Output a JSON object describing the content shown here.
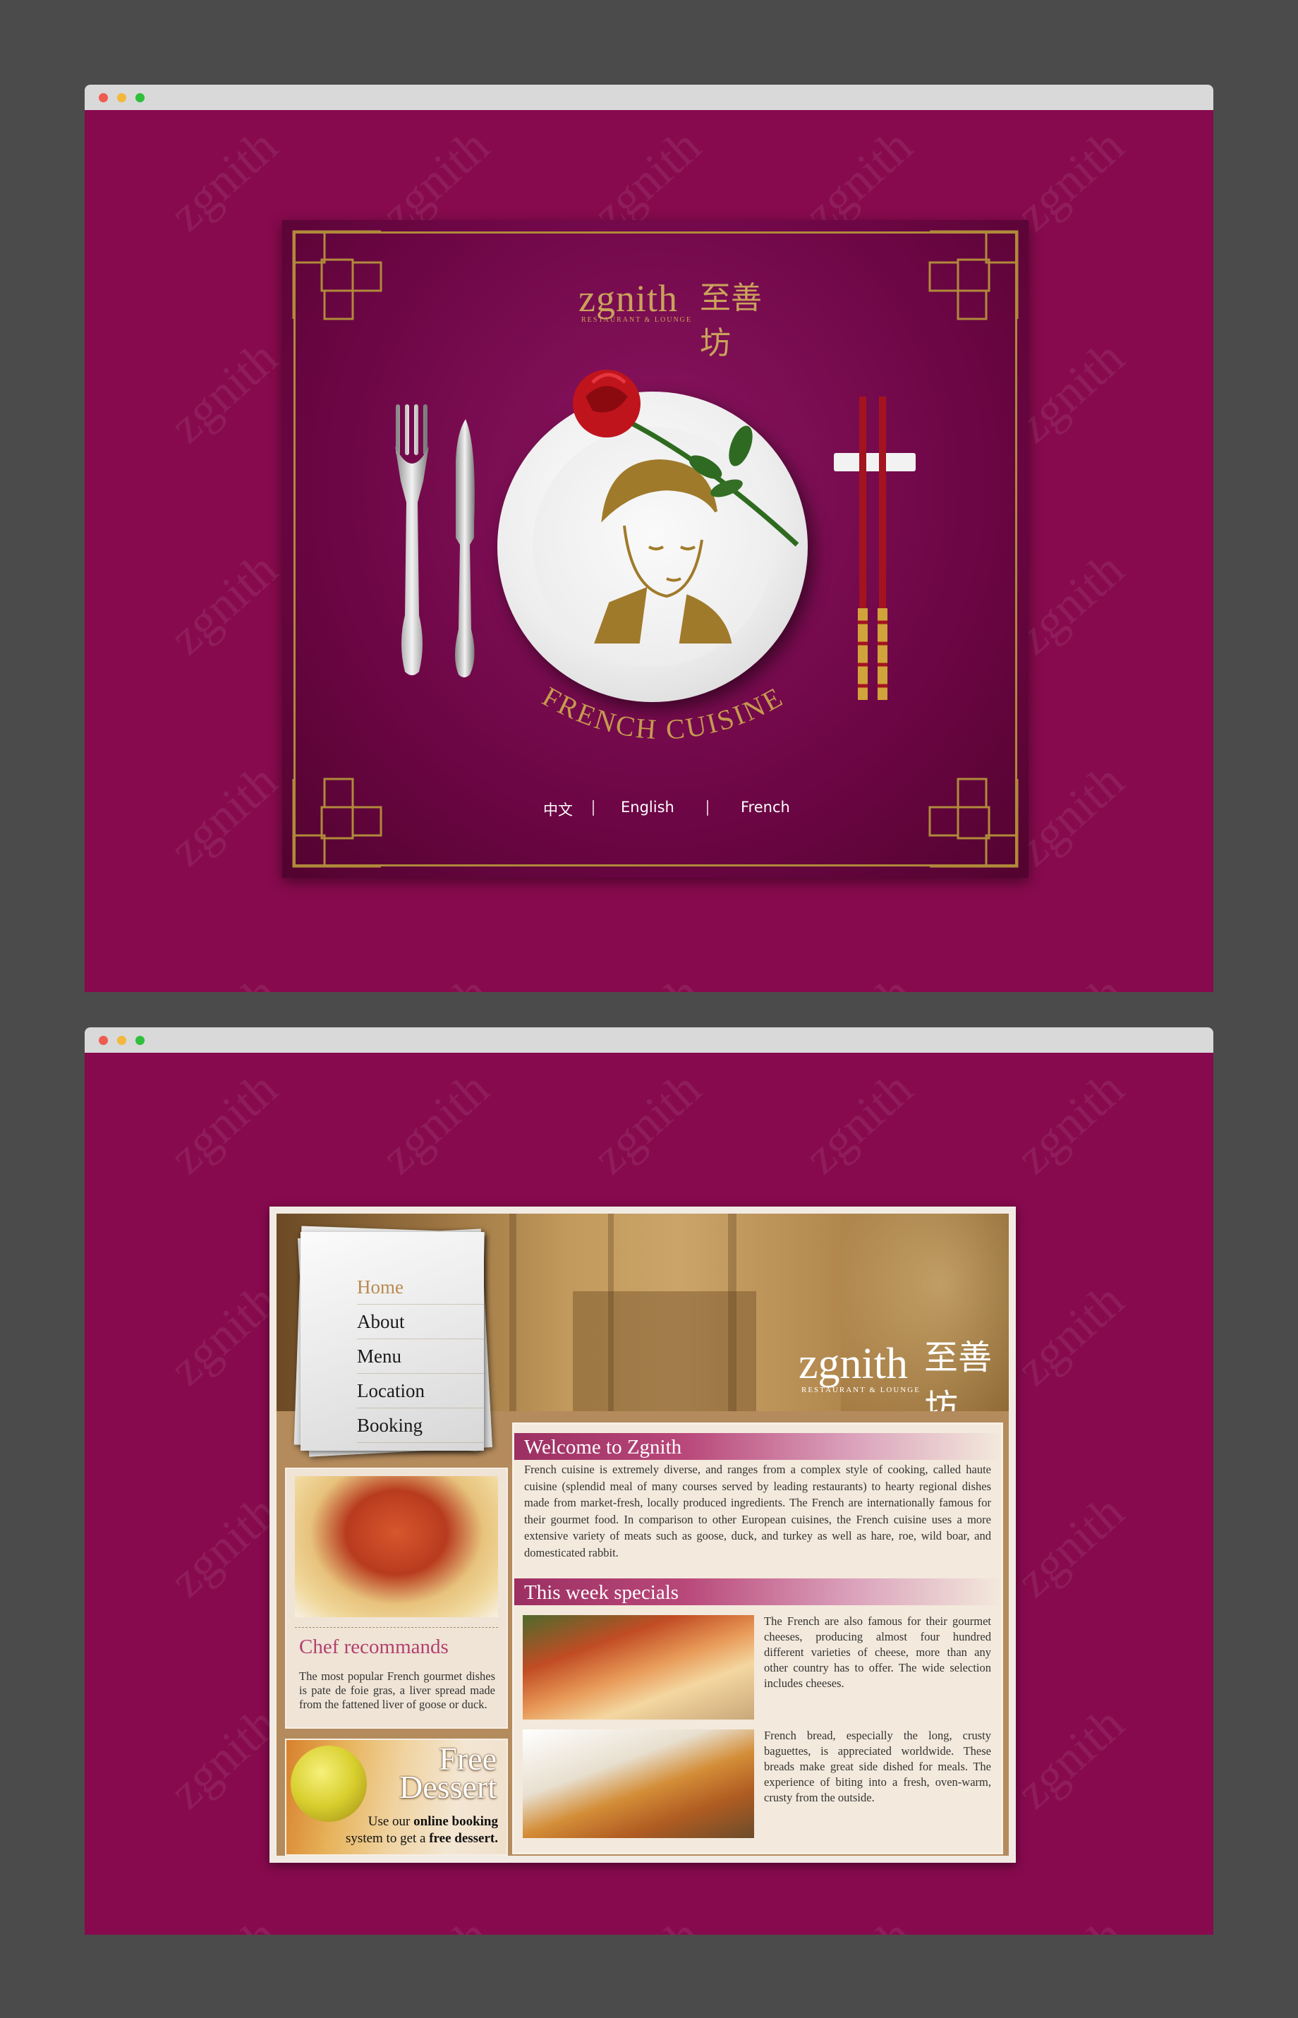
{
  "splash": {
    "brand": "zgnith",
    "brand_cn": "至善坊",
    "brand_tagline": "RESTAURANT & LOUNGE",
    "cuisine_text": "FRENCH CUISINE",
    "languages": [
      "中文",
      "English",
      "French"
    ]
  },
  "site": {
    "brand": "zgnith",
    "brand_cn": "至善坊",
    "brand_tagline": "RESTAURANT & LOUNGE",
    "nav": [
      {
        "label": "Home",
        "active": true
      },
      {
        "label": "About"
      },
      {
        "label": "Menu"
      },
      {
        "label": "Location"
      },
      {
        "label": "Booking"
      }
    ],
    "chef": {
      "title": "Chef recommands",
      "text": "The most popular French gourmet dishes is pate de foie gras, a liver spread made from the fattened liver of goose or duck."
    },
    "dessert": {
      "title_line1": "Free",
      "title_line2": "Dessert",
      "text_prefix": "Use our ",
      "text_bold": "online booking",
      "text_mid": " system to get a ",
      "text_bold2": "free dessert."
    },
    "welcome": {
      "title": "Welcome to Zgnith",
      "text": "French cuisine is extremely diverse, and ranges from a complex style of cooking, called haute cuisine (splendid meal of many courses served by leading restaurants) to hearty regional dishes made from market-fresh, locally produced ingredients. The French are internationally famous for their gourmet food. In comparison to other European cuisines, the French cuisine uses a more extensive variety of meats such as goose, duck, and turkey as well as hare, roe, wild boar, and domesticated rabbit."
    },
    "specials": {
      "title": "This week specials",
      "items": [
        {
          "text": "The French are also famous for their gourmet cheeses, producing almost four hundred different varieties of cheese, more than any other country has to offer. The wide selection includes cheeses."
        },
        {
          "text": "French bread, especially the long, crusty baguettes, is appreciated worldwide. These breads make great side dished for meals. The experience of biting into a fresh, oven-warm, crusty from the outside."
        }
      ]
    }
  },
  "colors": {
    "page_bg": "#870a4e",
    "gold": "#c9a25b",
    "bar": "#9c2f62",
    "chef_title": "#b2416f"
  }
}
